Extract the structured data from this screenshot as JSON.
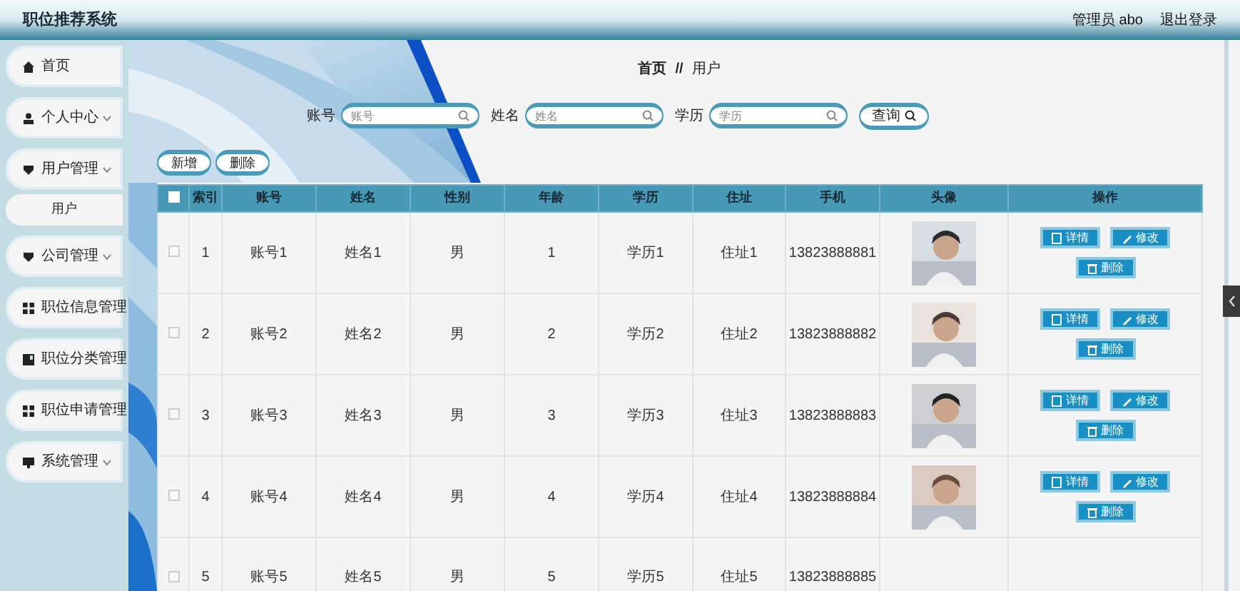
{
  "header": {
    "title": "职位推荐系统",
    "user": "管理员 abo",
    "logout": "退出登录"
  },
  "sidebar": {
    "items": [
      {
        "kind": "link",
        "label": "首页",
        "selected": false
      },
      {
        "kind": "group",
        "label": "个人中心",
        "selected": false
      },
      {
        "kind": "group",
        "label": "用户管理",
        "selected": false,
        "children": [
          {
            "label": "用户",
            "selected": true
          }
        ]
      },
      {
        "kind": "group",
        "label": "公司管理",
        "selected": false
      },
      {
        "kind": "group",
        "label": "职位信息管理",
        "selected": false
      },
      {
        "kind": "group",
        "label": "职位分类管理",
        "selected": false
      },
      {
        "kind": "group",
        "label": "职位申请管理",
        "selected": false
      },
      {
        "kind": "group",
        "label": "系统管理",
        "selected": false
      }
    ]
  },
  "breadcrumb": {
    "items": [
      "首页",
      "用户"
    ],
    "separator": "//"
  },
  "search": {
    "fields": [
      {
        "label": "账号",
        "placeholder": "账号"
      },
      {
        "label": "姓名",
        "placeholder": "姓名"
      },
      {
        "label": "学历",
        "placeholder": "学历"
      }
    ],
    "button": "查询"
  },
  "actions": [
    "新增",
    "删除"
  ],
  "table": {
    "select_all": {
      "checked": false
    },
    "columns": [
      "索引",
      "账号",
      "姓名",
      "性别",
      "年龄",
      "学历",
      "住址",
      "手机",
      "头像",
      "操作"
    ],
    "rows": [
      {
        "checked": false,
        "cells": [
          "1",
          "账号1",
          "姓名1",
          "男",
          "1",
          "学历1",
          "住址1",
          "13823888881"
        ],
        "buttons": [
          "详情",
          "修改",
          "删除"
        ]
      },
      {
        "checked": false,
        "cells": [
          "2",
          "账号2",
          "姓名2",
          "男",
          "2",
          "学历2",
          "住址2",
          "13823888882"
        ],
        "buttons": [
          "详情",
          "修改",
          "删除"
        ]
      },
      {
        "checked": false,
        "cells": [
          "3",
          "账号3",
          "姓名3",
          "男",
          "3",
          "学历3",
          "住址3",
          "13823888883"
        ],
        "buttons": [
          "详情",
          "修改",
          "删除"
        ]
      },
      {
        "checked": false,
        "cells": [
          "4",
          "账号4",
          "姓名4",
          "男",
          "4",
          "学历4",
          "住址4",
          "13823888884"
        ],
        "buttons": [
          "详情",
          "修改",
          "删除"
        ]
      },
      {
        "checked": false,
        "cells": [
          "5",
          "账号5",
          "姓名5",
          "男",
          "5",
          "学历5",
          "住址5",
          "13823888885"
        ]
      }
    ]
  }
}
